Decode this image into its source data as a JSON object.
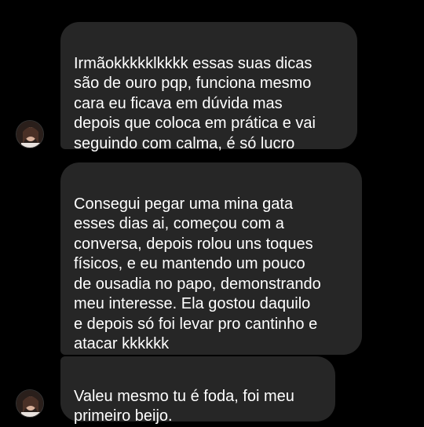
{
  "conversation": {
    "messages": [
      {
        "text": "Irmãokkkkklkkkk essas suas dicas\nsão de ouro pqp, funciona mesmo\ncara eu ficava em dúvida mas\ndepois que coloca em prática e vai\nseguindo com calma, é só lucro"
      },
      {
        "text": "Consegui pegar uma mina gata\nesses dias ai, começou com a\nconversa, depois rolou uns toques\nfísicos, e eu mantendo um pouco\nde ousadia no papo, demonstrando\nmeu interesse. Ela gostou daquilo\ne depois só foi levar pro cantinho e\natacar kkkkkk"
      },
      {
        "text": "Valeu mesmo tu é foda, foi meu\nprimeiro beijo."
      }
    ]
  },
  "theme": {
    "background": "#000000",
    "bubble_color": "#262626",
    "text_color": "#ffffff"
  },
  "icons": {
    "avatar": "sender-avatar-photo"
  }
}
